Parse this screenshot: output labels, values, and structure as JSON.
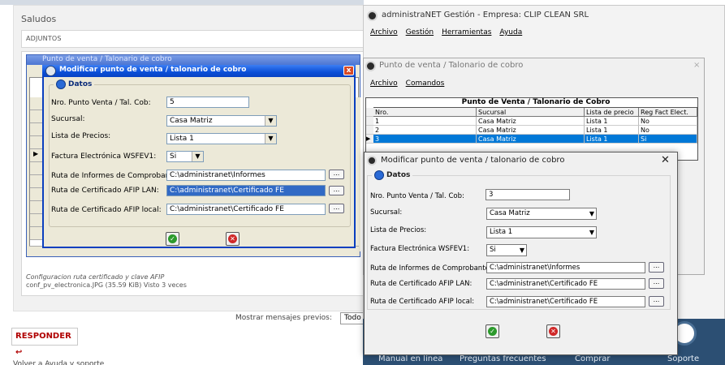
{
  "forum": {
    "salutation": "Saludos",
    "adjuntos_label": "ADJUNTOS",
    "caption": "Configuracion ruta certificado y clave AFIP",
    "caption2": "conf_pv_electronica.JPG (35.59 KiB) Visto 3 veces",
    "mostrar_label": "Mostrar mensajes previos:",
    "mostrar_value": "Todo",
    "reply_button": "RESPONDER ↩",
    "footer_link": "Volver a Ayuda y soporte"
  },
  "xp_back": {
    "title": "Punto de venta / Talonario de cobro"
  },
  "xp_dialog": {
    "title": "Modificar punto de venta / talonario de cobro",
    "close_glyph": "x",
    "group_label": "Datos",
    "fields": {
      "nro_label": "Nro. Punto Venta / Tal. Cob:",
      "nro_value": "5",
      "sucursal_label": "Sucursal:",
      "sucursal_value": "Casa Matriz",
      "lista_label": "Lista de Precios:",
      "lista_value": "Lista 1",
      "factura_label": "Factura Electrónica WSFEV1:",
      "factura_value": "Si",
      "ruta_informes_label": "Ruta de Informes de Comprobantes:",
      "ruta_informes_value": "C:\\administranet\\Informes",
      "ruta_lan_label": "Ruta de Certificado AFIP LAN:",
      "ruta_lan_value": "C:\\administranet\\Certificado FE",
      "ruta_local_label": "Ruta de Certificado AFIP local:",
      "ruta_local_value": "C:\\administranet\\Certificado FE"
    },
    "dots": "..."
  },
  "main": {
    "title": "administraNET Gestión - Empresa: CLIP CLEAN SRL",
    "menu": [
      "Archivo",
      "Gestión",
      "Herramientas",
      "Ayuda"
    ]
  },
  "punto": {
    "title": "Punto de venta / Talonario de cobro",
    "close": "×",
    "menu": [
      "Archivo",
      "Comandos"
    ],
    "table_title": "Punto de Venta / Talonario de Cobro",
    "columns": [
      "Nro.",
      "Sucursal",
      "Lista de precio",
      "Reg Fact Elect."
    ],
    "rows": [
      [
        "1",
        "Casa Matriz",
        "Lista 1",
        "No"
      ],
      [
        "2",
        "Casa Matriz",
        "Lista 1",
        "No"
      ],
      [
        "3",
        "Casa Matriz",
        "Lista 1",
        "Si"
      ]
    ]
  },
  "modal": {
    "title": "Modificar punto de venta / talonario de cobro",
    "close": "✕",
    "group_label": "Datos",
    "fields": {
      "nro_label": "Nro. Punto Venta / Tal. Cob:",
      "nro_value": "3",
      "sucursal_label": "Sucursal:",
      "sucursal_value": "Casa Matriz",
      "lista_label": "Lista de Precios:",
      "lista_value": "Lista 1",
      "factura_label": "Factura Electrónica WSFEV1:",
      "factura_value": "Si",
      "ruta_informes_label": "Ruta de Informes de Comprobantes:",
      "ruta_informes_value": "C:\\administranet\\Informes",
      "ruta_lan_label": "Ruta de Certificado AFIP LAN:",
      "ruta_lan_value": "C:\\administranet\\Certificado FE",
      "ruta_local_label": "Ruta de Certificado AFIP local:",
      "ruta_local_value": "C:\\administranet\\Certificado FE"
    },
    "dots": "..."
  },
  "bottom_bar": {
    "items": [
      "Manual en línea",
      "Preguntas frecuentes",
      "Comprar",
      "Soporte"
    ]
  },
  "icons": {
    "ok": "check-icon",
    "cancel": "cancel-icon",
    "dropdown": "chevron-down-icon",
    "app": "app-logo-icon"
  },
  "colors": {
    "xp_title": "#0b4fd8",
    "selection": "#0078d7",
    "reply_red": "#b00000",
    "bottom_bar": "#2c4f73"
  }
}
